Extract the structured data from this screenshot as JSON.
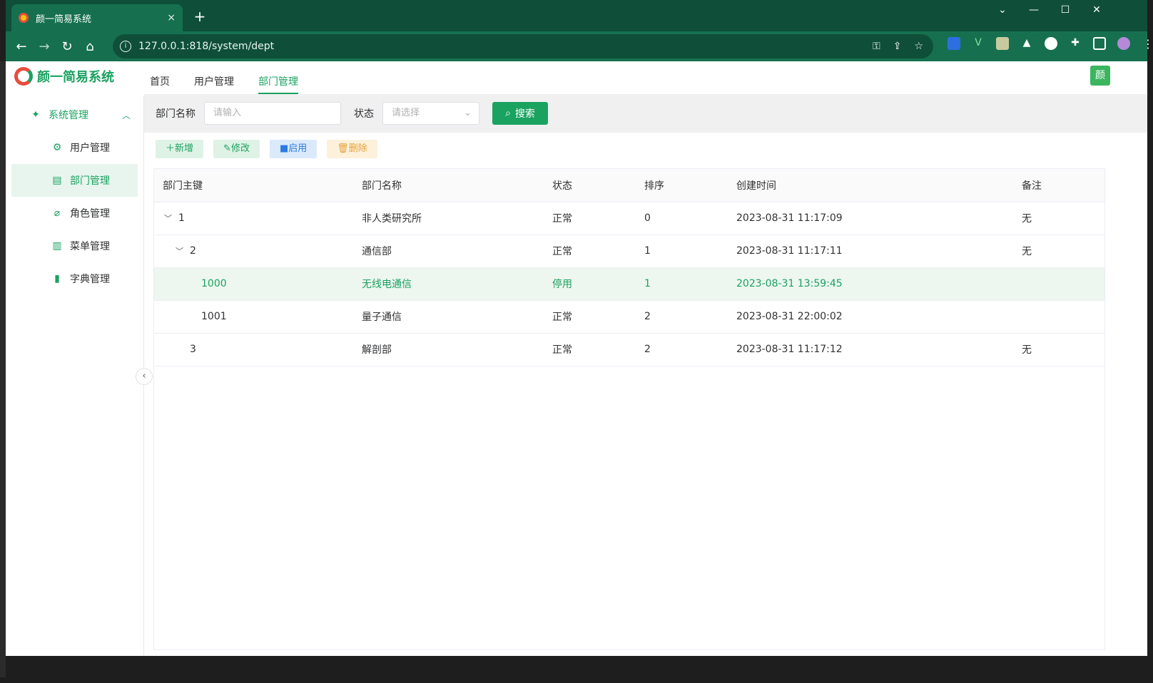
{
  "browser": {
    "tab_title": "颜一简易系统",
    "tab_close": "×",
    "new_tab": "+",
    "url": "127.0.0.1:818/system/dept",
    "win_min": "—",
    "win_max": "☐",
    "win_close": "✕",
    "win_more": "⌄"
  },
  "app": {
    "logo_text": "颜一简易系统",
    "avatar": "颜",
    "topnav": [
      {
        "label": "首页"
      },
      {
        "label": "用户管理"
      },
      {
        "label": "部门管理"
      }
    ],
    "sidebar": {
      "root": "系统管理",
      "items": [
        {
          "label": "用户管理",
          "icon": "gear-icon"
        },
        {
          "label": "部门管理",
          "icon": "archive-icon"
        },
        {
          "label": "角色管理",
          "icon": "paperclip-icon"
        },
        {
          "label": "菜单管理",
          "icon": "bar-chart-icon"
        },
        {
          "label": "字典管理",
          "icon": "book-icon"
        }
      ]
    },
    "search": {
      "dept_label": "部门名称",
      "dept_placeholder": "请输入",
      "status_label": "状态",
      "status_placeholder": "请选择",
      "search_button": "搜索"
    },
    "toolbar": {
      "add": "新增",
      "edit": "修改",
      "enable": "启用",
      "delete": "删除"
    },
    "table": {
      "headers": [
        "部门主键",
        "部门名称",
        "状态",
        "排序",
        "创建时间",
        "备注"
      ],
      "rows": [
        {
          "id": "1",
          "name": "非人类研究所",
          "status": "正常",
          "sort": "0",
          "created": "2023-08-31 11:17:09",
          "remark": "无"
        },
        {
          "id": "2",
          "name": "通信部",
          "status": "正常",
          "sort": "1",
          "created": "2023-08-31 11:17:11",
          "remark": "无"
        },
        {
          "id": "1000",
          "name": "无线电通信",
          "status": "停用",
          "sort": "1",
          "created": "2023-08-31 13:59:45",
          "remark": ""
        },
        {
          "id": "1001",
          "name": "量子通信",
          "status": "正常",
          "sort": "2",
          "created": "2023-08-31 22:00:02",
          "remark": ""
        },
        {
          "id": "3",
          "name": "解剖部",
          "status": "正常",
          "sort": "2",
          "created": "2023-08-31 11:17:12",
          "remark": "无"
        }
      ]
    }
  },
  "colors": {
    "accent": "#1aa260",
    "chrome": "#16704f"
  }
}
